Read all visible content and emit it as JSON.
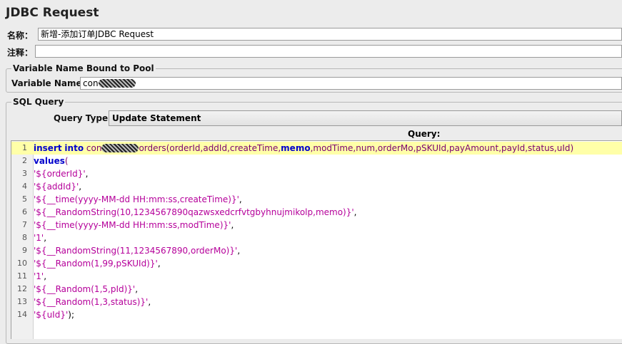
{
  "window": {
    "title": "JDBC Request"
  },
  "name_field": {
    "label": "名称：",
    "value": "新增-添加订单JDBC Request"
  },
  "comment_field": {
    "label": "注释：",
    "value": ""
  },
  "pool_group": {
    "title": "Variable Name Bound to Pool",
    "variable_label": "Variable Name:",
    "variable_value_prefix": "con"
  },
  "sql_group": {
    "title": "SQL Query",
    "query_type_label": "Query Type:",
    "query_type_value": "Update Statement",
    "query_header": "Query:"
  },
  "editor": {
    "line1": {
      "n": "1",
      "kw_insert": "insert",
      "kw_into": "into",
      "table_prefix": "con",
      "table_suffix": "orders",
      "cols_a": "(orderId,addId,createTime,",
      "kw_memo": "memo",
      "cols_b": ",modTime,num,orderMo,pSKUId,payAmount,payId,status,uId)"
    },
    "line2": {
      "n": "2",
      "kw": "values",
      "paren": "("
    },
    "line3": {
      "n": "3",
      "str": "'${orderId}'",
      "tail": ","
    },
    "line4": {
      "n": "4",
      "str": "'${addId}'",
      "tail": ","
    },
    "line5": {
      "n": "5",
      "str": "'${__time(yyyy-MM-dd HH:mm:ss,createTime)}'",
      "tail": ","
    },
    "line6": {
      "n": "6",
      "str": "'${__RandomString(10,1234567890qazwsxedcrfvtgbyhnujmikolp,memo)}'",
      "tail": ","
    },
    "line7": {
      "n": "7",
      "str": "'${__time(yyyy-MM-dd HH:mm:ss,modTime)}'",
      "tail": ","
    },
    "line8": {
      "n": "8",
      "str": "'1'",
      "tail": ","
    },
    "line9": {
      "n": "9",
      "str": "'${__RandomString(11,1234567890,orderMo)}'",
      "tail": ","
    },
    "line10": {
      "n": "10",
      "str": "'${__Random(1,99,pSKUId)}'",
      "tail": ","
    },
    "line11": {
      "n": "11",
      "str": "'1'",
      "tail": ","
    },
    "line12": {
      "n": "12",
      "str": "'${__Random(1,5,pId)}'",
      "tail": ","
    },
    "line13": {
      "n": "13",
      "str": "'${__Random(1,3,status)}'",
      "tail": ","
    },
    "line14": {
      "n": "14",
      "str": "'${uId}'",
      "tail": ");"
    }
  },
  "colors": {
    "keyword": "#0000cc",
    "string": "#b5009a",
    "current_line": "#ffffa8"
  }
}
